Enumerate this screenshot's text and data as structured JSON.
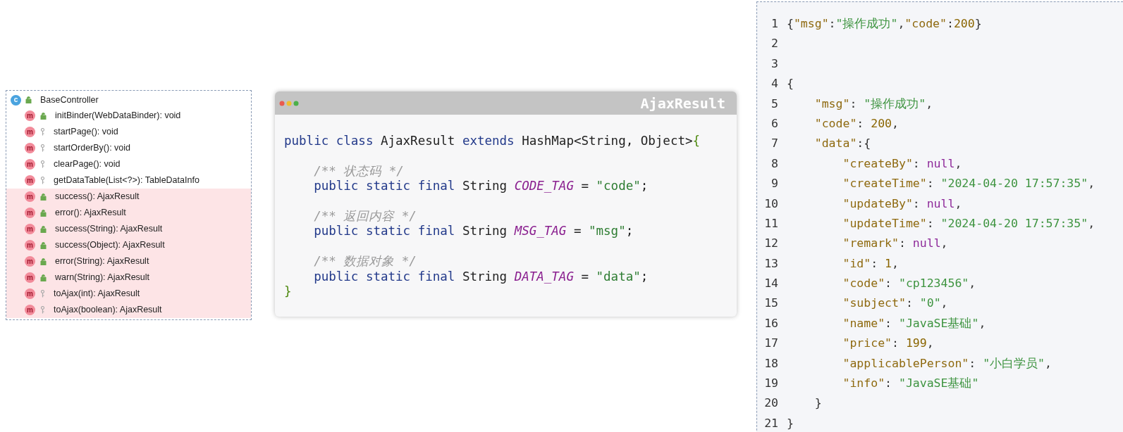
{
  "structure": {
    "class_badge": "c",
    "label": "BaseController",
    "kind": "public",
    "methods": [
      {
        "badge": "m",
        "label": "initBinder(WebDataBinder): void",
        "kind": "public",
        "highlighted": false
      },
      {
        "badge": "m",
        "label": "startPage(): void",
        "kind": "protected",
        "highlighted": false
      },
      {
        "badge": "m",
        "label": "startOrderBy(): void",
        "kind": "protected",
        "highlighted": false
      },
      {
        "badge": "m",
        "label": "clearPage(): void",
        "kind": "protected",
        "highlighted": false
      },
      {
        "badge": "m",
        "label": "getDataTable(List<?>): TableDataInfo",
        "kind": "protected",
        "highlighted": false
      },
      {
        "badge": "m",
        "label": "success(): AjaxResult",
        "kind": "public",
        "highlighted": true
      },
      {
        "badge": "m",
        "label": "error(): AjaxResult",
        "kind": "public",
        "highlighted": true
      },
      {
        "badge": "m",
        "label": "success(String): AjaxResult",
        "kind": "public",
        "highlighted": true
      },
      {
        "badge": "m",
        "label": "success(Object): AjaxResult",
        "kind": "public",
        "highlighted": true
      },
      {
        "badge": "m",
        "label": "error(String): AjaxResult",
        "kind": "public",
        "highlighted": true
      },
      {
        "badge": "m",
        "label": "warn(String): AjaxResult",
        "kind": "public",
        "highlighted": true
      },
      {
        "badge": "m",
        "label": "toAjax(int): AjaxResult",
        "kind": "protected",
        "highlighted": true
      },
      {
        "badge": "m",
        "label": "toAjax(boolean): AjaxResult",
        "kind": "protected",
        "highlighted": true
      }
    ]
  },
  "code_window": {
    "title": "AjaxResult",
    "lines": [
      {
        "kind": "code",
        "tokens": [
          {
            "t": "public class ",
            "kind": "keyword"
          },
          {
            "t": "AjaxResult ",
            "kind": "plain"
          },
          {
            "t": "extends ",
            "kind": "keyword"
          },
          {
            "t": "HashMap<String, Object>",
            "kind": "plain"
          },
          {
            "t": "{",
            "kind": "bracket"
          }
        ]
      },
      {
        "kind": "blank"
      },
      {
        "kind": "code",
        "tokens": [
          {
            "t": "    /** 状态码 */",
            "kind": "comment"
          }
        ]
      },
      {
        "kind": "code",
        "tokens": [
          {
            "t": "    public static final ",
            "kind": "keyword"
          },
          {
            "t": "String ",
            "kind": "plain"
          },
          {
            "t": "CODE_TAG",
            "kind": "constant"
          },
          {
            "t": " = ",
            "kind": "plain"
          },
          {
            "t": "\"code\"",
            "kind": "string"
          },
          {
            "t": ";",
            "kind": "plain"
          }
        ]
      },
      {
        "kind": "blank"
      },
      {
        "kind": "code",
        "tokens": [
          {
            "t": "    /** 返回内容 */",
            "kind": "comment"
          }
        ]
      },
      {
        "kind": "code",
        "tokens": [
          {
            "t": "    public static final ",
            "kind": "keyword"
          },
          {
            "t": "String ",
            "kind": "plain"
          },
          {
            "t": "MSG_TAG",
            "kind": "constant"
          },
          {
            "t": " = ",
            "kind": "plain"
          },
          {
            "t": "\"msg\"",
            "kind": "string"
          },
          {
            "t": ";",
            "kind": "plain"
          }
        ]
      },
      {
        "kind": "blank"
      },
      {
        "kind": "code",
        "tokens": [
          {
            "t": "    /** 数据对象 */",
            "kind": "comment"
          }
        ]
      },
      {
        "kind": "code",
        "tokens": [
          {
            "t": "    public static final ",
            "kind": "keyword"
          },
          {
            "t": "String ",
            "kind": "plain"
          },
          {
            "t": "DATA_TAG",
            "kind": "constant"
          },
          {
            "t": " = ",
            "kind": "plain"
          },
          {
            "t": "\"data\"",
            "kind": "string"
          },
          {
            "t": ";",
            "kind": "plain"
          }
        ]
      },
      {
        "kind": "code",
        "tokens": [
          {
            "t": "}",
            "kind": "bracket"
          }
        ]
      }
    ]
  },
  "json_viewer": {
    "lines": [
      {
        "number": "1",
        "tokens": [
          {
            "t": "{",
            "kind": "punct"
          },
          {
            "t": "\"msg\"",
            "kind": "key"
          },
          {
            "t": ":",
            "kind": "punct"
          },
          {
            "t": "\"操作成功\"",
            "kind": "string"
          },
          {
            "t": ",",
            "kind": "punct"
          },
          {
            "t": "\"code\"",
            "kind": "key"
          },
          {
            "t": ":",
            "kind": "punct"
          },
          {
            "t": "200",
            "kind": "number"
          },
          {
            "t": "}",
            "kind": "punct"
          }
        ]
      },
      {
        "number": "2"
      },
      {
        "number": "3"
      },
      {
        "number": "4",
        "tokens": [
          {
            "t": "{",
            "kind": "punct"
          }
        ]
      },
      {
        "number": "5",
        "tokens": [
          {
            "t": "    \"msg\"",
            "kind": "key"
          },
          {
            "t": ": ",
            "kind": "punct"
          },
          {
            "t": "\"操作成功\"",
            "kind": "string"
          },
          {
            "t": ",",
            "kind": "punct"
          }
        ]
      },
      {
        "number": "6",
        "tokens": [
          {
            "t": "    \"code\"",
            "kind": "key"
          },
          {
            "t": ": ",
            "kind": "punct"
          },
          {
            "t": "200",
            "kind": "number"
          },
          {
            "t": ",",
            "kind": "punct"
          }
        ]
      },
      {
        "number": "7",
        "tokens": [
          {
            "t": "    \"data\"",
            "kind": "key"
          },
          {
            "t": ":{",
            "kind": "punct"
          }
        ]
      },
      {
        "number": "8",
        "tokens": [
          {
            "t": "        \"createBy\"",
            "kind": "key"
          },
          {
            "t": ": ",
            "kind": "punct"
          },
          {
            "t": "null",
            "kind": "null"
          },
          {
            "t": ",",
            "kind": "punct"
          }
        ]
      },
      {
        "number": "9",
        "tokens": [
          {
            "t": "        \"createTime\"",
            "kind": "key"
          },
          {
            "t": ": ",
            "kind": "punct"
          },
          {
            "t": "\"2024-04-20 17:57:35\"",
            "kind": "string"
          },
          {
            "t": ",",
            "kind": "punct"
          }
        ]
      },
      {
        "number": "10",
        "tokens": [
          {
            "t": "        \"updateBy\"",
            "kind": "key"
          },
          {
            "t": ": ",
            "kind": "punct"
          },
          {
            "t": "null",
            "kind": "null"
          },
          {
            "t": ",",
            "kind": "punct"
          }
        ]
      },
      {
        "number": "11",
        "tokens": [
          {
            "t": "        \"updateTime\"",
            "kind": "key"
          },
          {
            "t": ": ",
            "kind": "punct"
          },
          {
            "t": "\"2024-04-20 17:57:35\"",
            "kind": "string"
          },
          {
            "t": ",",
            "kind": "punct"
          }
        ]
      },
      {
        "number": "12",
        "tokens": [
          {
            "t": "        \"remark\"",
            "kind": "key"
          },
          {
            "t": ": ",
            "kind": "punct"
          },
          {
            "t": "null",
            "kind": "null"
          },
          {
            "t": ",",
            "kind": "punct"
          }
        ]
      },
      {
        "number": "13",
        "tokens": [
          {
            "t": "        \"id\"",
            "kind": "key"
          },
          {
            "t": ": ",
            "kind": "punct"
          },
          {
            "t": "1",
            "kind": "number"
          },
          {
            "t": ",",
            "kind": "punct"
          }
        ]
      },
      {
        "number": "14",
        "tokens": [
          {
            "t": "        \"code\"",
            "kind": "key"
          },
          {
            "t": ": ",
            "kind": "punct"
          },
          {
            "t": "\"cp123456\"",
            "kind": "string"
          },
          {
            "t": ",",
            "kind": "punct"
          }
        ]
      },
      {
        "number": "15",
        "tokens": [
          {
            "t": "        \"subject\"",
            "kind": "key"
          },
          {
            "t": ": ",
            "kind": "punct"
          },
          {
            "t": "\"0\"",
            "kind": "string"
          },
          {
            "t": ",",
            "kind": "punct"
          }
        ]
      },
      {
        "number": "16",
        "tokens": [
          {
            "t": "        \"name\"",
            "kind": "key"
          },
          {
            "t": ": ",
            "kind": "punct"
          },
          {
            "t": "\"JavaSE基础\"",
            "kind": "string"
          },
          {
            "t": ",",
            "kind": "punct"
          }
        ]
      },
      {
        "number": "17",
        "tokens": [
          {
            "t": "        \"price\"",
            "kind": "key"
          },
          {
            "t": ": ",
            "kind": "punct"
          },
          {
            "t": "199",
            "kind": "number"
          },
          {
            "t": ",",
            "kind": "punct"
          }
        ]
      },
      {
        "number": "18",
        "tokens": [
          {
            "t": "        \"applicablePerson\"",
            "kind": "key"
          },
          {
            "t": ": ",
            "kind": "punct"
          },
          {
            "t": "\"小白学员\"",
            "kind": "string"
          },
          {
            "t": ",",
            "kind": "punct"
          }
        ]
      },
      {
        "number": "19",
        "tokens": [
          {
            "t": "        \"info\"",
            "kind": "key"
          },
          {
            "t": ": ",
            "kind": "punct"
          },
          {
            "t": "\"JavaSE基础\"",
            "kind": "string"
          }
        ]
      },
      {
        "number": "20",
        "tokens": [
          {
            "t": "    }",
            "kind": "punct"
          }
        ]
      },
      {
        "number": "21",
        "tokens": [
          {
            "t": "}",
            "kind": "punct"
          }
        ]
      }
    ]
  }
}
